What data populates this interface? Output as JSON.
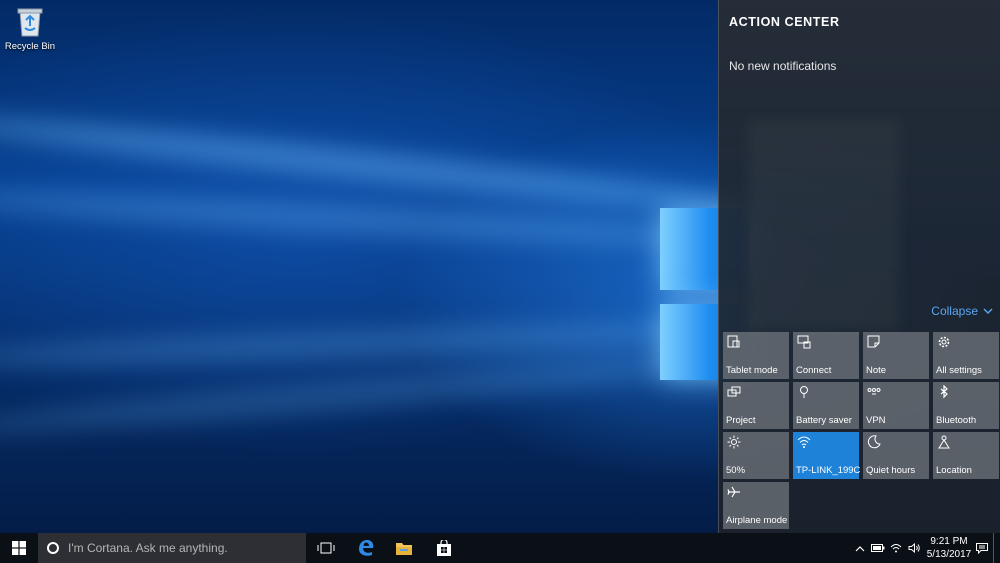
{
  "desktop": {
    "icons": [
      {
        "label": "Recycle Bin",
        "icon": "recycle-bin-icon"
      }
    ]
  },
  "action_center": {
    "title": "ACTION CENTER",
    "empty_message": "No new notifications",
    "collapse_label": "Collapse",
    "tiles": [
      {
        "label": "Tablet mode",
        "icon": "tablet-mode-icon",
        "active": false
      },
      {
        "label": "Connect",
        "icon": "connect-icon",
        "active": false
      },
      {
        "label": "Note",
        "icon": "note-icon",
        "active": false
      },
      {
        "label": "All settings",
        "icon": "gear-icon",
        "active": false
      },
      {
        "label": "Project",
        "icon": "project-icon",
        "active": false
      },
      {
        "label": "Battery saver",
        "icon": "battery-saver-icon",
        "active": false
      },
      {
        "label": "VPN",
        "icon": "vpn-icon",
        "active": false
      },
      {
        "label": "Bluetooth",
        "icon": "bluetooth-icon",
        "active": false
      },
      {
        "label": "50%",
        "icon": "brightness-icon",
        "active": false
      },
      {
        "label": "TP-LINK_199C",
        "icon": "wifi-icon",
        "active": true
      },
      {
        "label": "Quiet hours",
        "icon": "moon-icon",
        "active": false
      },
      {
        "label": "Location",
        "icon": "location-icon",
        "active": false
      },
      {
        "label": "Airplane mode",
        "icon": "airplane-icon",
        "active": false
      }
    ],
    "accent_color": "#1e83d8"
  },
  "taskbar": {
    "search_placeholder": "I'm Cortana. Ask me anything.",
    "pinned": [
      "task-view-icon",
      "edge-icon",
      "file-explorer-icon",
      "store-icon"
    ],
    "tray_icons": [
      "chevron-up-icon",
      "battery-icon",
      "wifi-icon",
      "volume-icon",
      "action-center-icon"
    ],
    "clock": {
      "time": "9:21 PM",
      "date": "5/13/2017"
    }
  }
}
